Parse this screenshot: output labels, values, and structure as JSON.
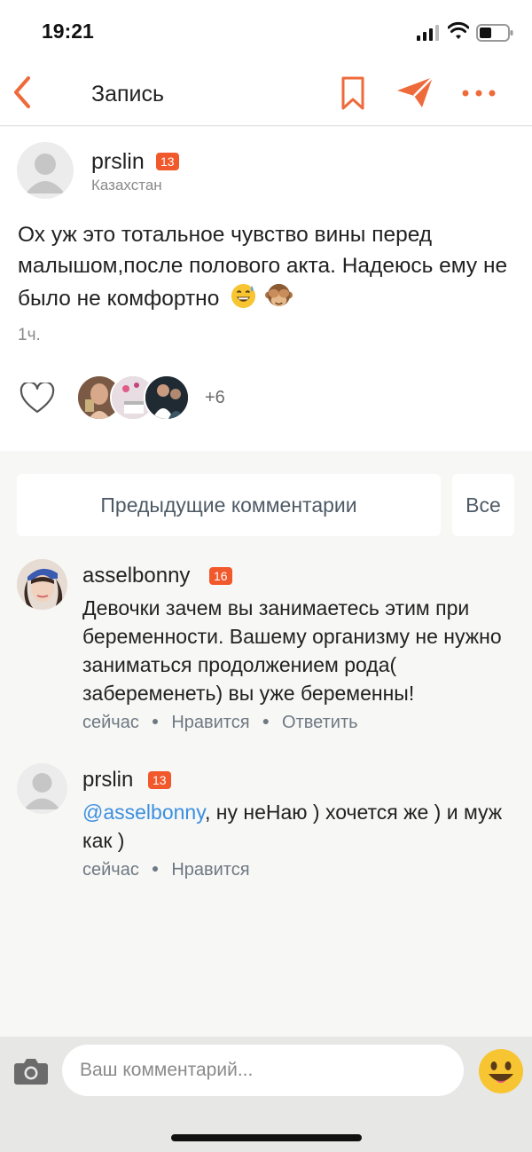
{
  "status_bar": {
    "time": "19:21"
  },
  "nav": {
    "title": "Запись"
  },
  "post": {
    "author": "prslin",
    "badge": "13",
    "location": "Казахстан",
    "text": "Ох уж это тотальное чувство вины перед малышом,после полового акта. Надеюсь ему не было не комфортно",
    "emojis": [
      "grinning-sweat-emoji",
      "see-no-evil-monkey-emoji"
    ],
    "time": "1ч.",
    "likes_more": "+6"
  },
  "comments_controls": {
    "previous_label": "Предыдущие комментарии",
    "all_label": "Все"
  },
  "comments": [
    {
      "author": "asselbonny",
      "badge": "16",
      "text": "Девочки зачем вы занимаетесь этим при беременности. Вашему организму не нужно заниматься продолжением рода( забеременеть) вы уже беременны!",
      "time": "сейчас",
      "like_label": "Нравится",
      "reply_label": "Ответить"
    },
    {
      "author": "prslin",
      "badge": "13",
      "mention": "@asselbonny",
      "text": ", ну неНаю ) хочется же ) и муж как )",
      "time": "сейчас",
      "like_label": "Нравится"
    }
  ],
  "composer": {
    "placeholder": "Ваш комментарий..."
  },
  "colors": {
    "accent": "#f1582b",
    "link": "#3b8fe0",
    "meta": "#6e7983"
  }
}
